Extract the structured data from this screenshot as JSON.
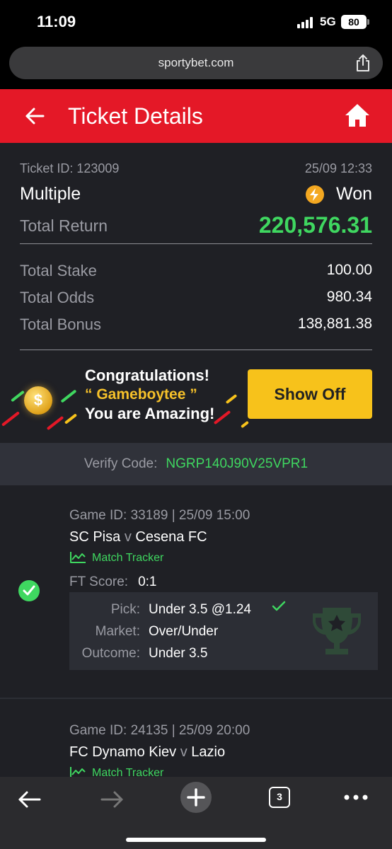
{
  "status_bar": {
    "time": "11:09",
    "network": "5G",
    "battery": "80"
  },
  "browser": {
    "url": "sportybet.com",
    "tabs_count": "3"
  },
  "header": {
    "title": "Ticket Details"
  },
  "ticket": {
    "id_text": "Ticket ID: 123009",
    "datetime": "25/09 12:33",
    "type": "Multiple",
    "status": "Won",
    "total_return_label": "Total Return",
    "total_return": "220,576.31",
    "stake_label": "Total Stake",
    "stake": "100.00",
    "odds_label": "Total Odds",
    "odds": "980.34",
    "bonus_label": "Total Bonus",
    "bonus": "138,881.38"
  },
  "banner": {
    "line1": "Congratulations!",
    "line2": "“ Gameboytee ”",
    "line3": "You are Amazing!",
    "button": "Show Off",
    "coin_symbol": "$"
  },
  "verify": {
    "label": "Verify Code:",
    "code": "NGRP140J90V25VPR1"
  },
  "bets": [
    {
      "game_id": "Game ID: 33189 | 25/09 15:00",
      "home": "SC Pisa",
      "vs": "v",
      "away": "Cesena FC",
      "tracker": "Match Tracker",
      "ft_label": "FT Score:",
      "ft_score": "0:1",
      "pick_label": "Pick:",
      "pick": "Under 3.5 @1.24",
      "market_label": "Market:",
      "market": "Over/Under",
      "outcome_label": "Outcome:",
      "outcome": "Under 3.5"
    },
    {
      "game_id": "Game ID: 24135 | 25/09 20:00",
      "home": "FC Dynamo Kiev",
      "vs": "v",
      "away": "Lazio",
      "tracker": "Match Tracker"
    }
  ],
  "colors": {
    "brand_red": "#e41827",
    "win_green": "#3fd760",
    "gold": "#f7c21b"
  }
}
